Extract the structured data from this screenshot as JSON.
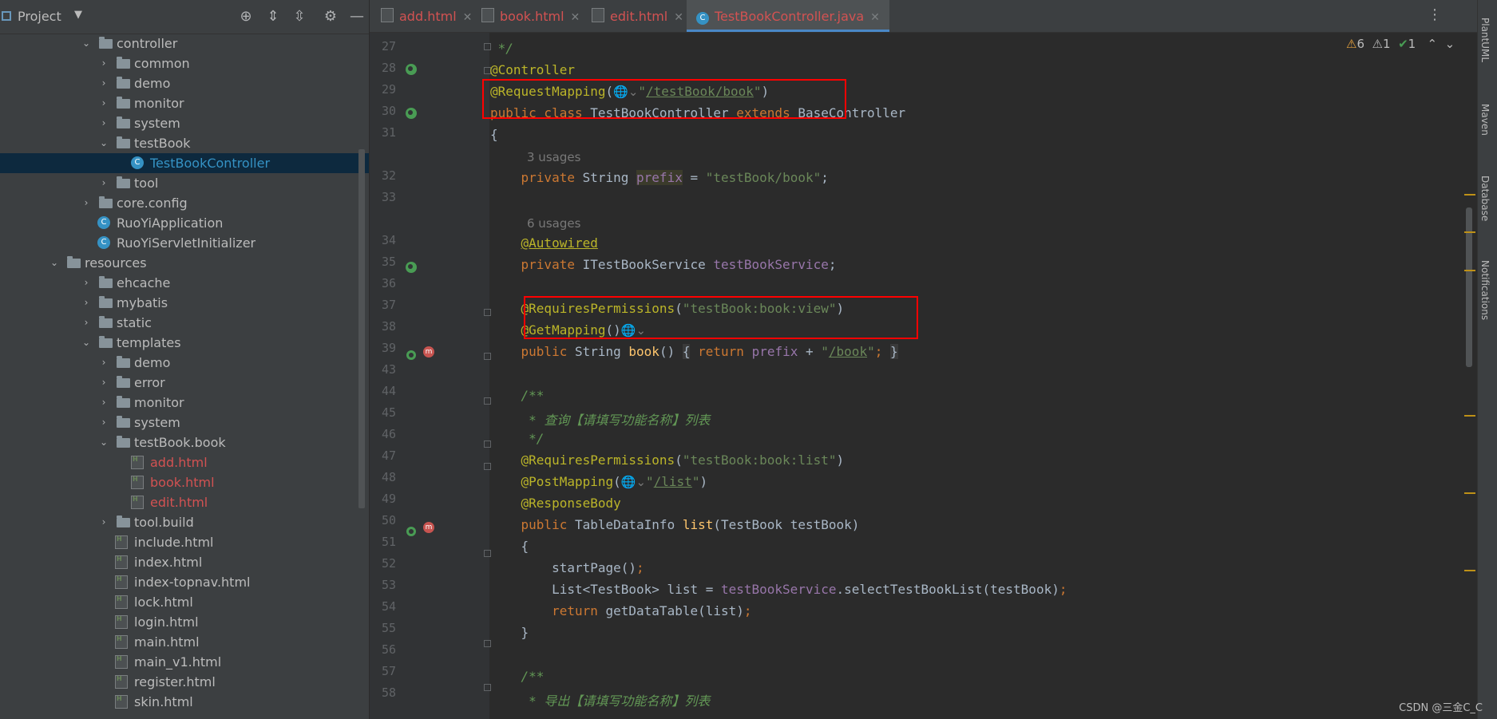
{
  "project": {
    "title": "Project",
    "tree": [
      {
        "label": "controller",
        "type": "folder",
        "level": 1,
        "open": true
      },
      {
        "label": "common",
        "type": "folder",
        "level": 2,
        "open": false
      },
      {
        "label": "demo",
        "type": "folder",
        "level": 2,
        "open": false
      },
      {
        "label": "monitor",
        "type": "folder",
        "level": 2,
        "open": false
      },
      {
        "label": "system",
        "type": "folder",
        "level": 2,
        "open": false
      },
      {
        "label": "testBook",
        "type": "folder",
        "level": 2,
        "open": true
      },
      {
        "label": "TestBookController",
        "type": "class",
        "level": 3,
        "selected": true
      },
      {
        "label": "tool",
        "type": "folder",
        "level": 2,
        "open": false
      },
      {
        "label": "core.config",
        "type": "folder",
        "level": 1,
        "open": false
      },
      {
        "label": "RuoYiApplication",
        "type": "class",
        "level": 1
      },
      {
        "label": "RuoYiServletInitializer",
        "type": "class",
        "level": 1
      },
      {
        "label": "resources",
        "type": "folder",
        "level": 0,
        "open": true
      },
      {
        "label": "ehcache",
        "type": "folder",
        "level": 1,
        "open": false
      },
      {
        "label": "mybatis",
        "type": "folder",
        "level": 1,
        "open": false
      },
      {
        "label": "static",
        "type": "folder",
        "level": 1,
        "open": false
      },
      {
        "label": "templates",
        "type": "folder",
        "level": 1,
        "open": true
      },
      {
        "label": "demo",
        "type": "folder",
        "level": 2,
        "open": false
      },
      {
        "label": "error",
        "type": "folder",
        "level": 2,
        "open": false
      },
      {
        "label": "monitor",
        "type": "folder",
        "level": 2,
        "open": false
      },
      {
        "label": "system",
        "type": "folder",
        "level": 2,
        "open": false
      },
      {
        "label": "testBook.book",
        "type": "folder",
        "level": 2,
        "open": true
      },
      {
        "label": "add.html",
        "type": "html",
        "level": 3,
        "modified": true
      },
      {
        "label": "book.html",
        "type": "html",
        "level": 3,
        "modified": true
      },
      {
        "label": "edit.html",
        "type": "html",
        "level": 3,
        "modified": true
      },
      {
        "label": "tool.build",
        "type": "folder",
        "level": 2,
        "open": false
      },
      {
        "label": "include.html",
        "type": "html",
        "level": 2
      },
      {
        "label": "index.html",
        "type": "html",
        "level": 2
      },
      {
        "label": "index-topnav.html",
        "type": "html",
        "level": 2
      },
      {
        "label": "lock.html",
        "type": "html",
        "level": 2
      },
      {
        "label": "login.html",
        "type": "html",
        "level": 2
      },
      {
        "label": "main.html",
        "type": "html",
        "level": 2
      },
      {
        "label": "main_v1.html",
        "type": "html",
        "level": 2
      },
      {
        "label": "register.html",
        "type": "html",
        "level": 2
      },
      {
        "label": "skin.html",
        "type": "html",
        "level": 2
      }
    ]
  },
  "tabs": [
    {
      "label": "add.html",
      "active": false
    },
    {
      "label": "book.html",
      "active": false
    },
    {
      "label": "edit.html",
      "active": false
    },
    {
      "label": "TestBookController.java",
      "active": true
    }
  ],
  "inspections": {
    "warnings": "6",
    "weak": "1",
    "ok": "1"
  },
  "right_tools": [
    "PlantUML",
    "Maven",
    "Database",
    "Notifications"
  ],
  "watermark": "CSDN @三金C_C",
  "line_numbers": [
    "27",
    "28",
    "29",
    "30",
    "31",
    "",
    "32",
    "33",
    "",
    "34",
    "35",
    "36",
    "37",
    "38",
    "39",
    "43",
    "44",
    "45",
    "46",
    "47",
    "48",
    "49",
    "50",
    "51",
    "52",
    "53",
    "54",
    "55",
    "56",
    "57",
    "58"
  ]
}
